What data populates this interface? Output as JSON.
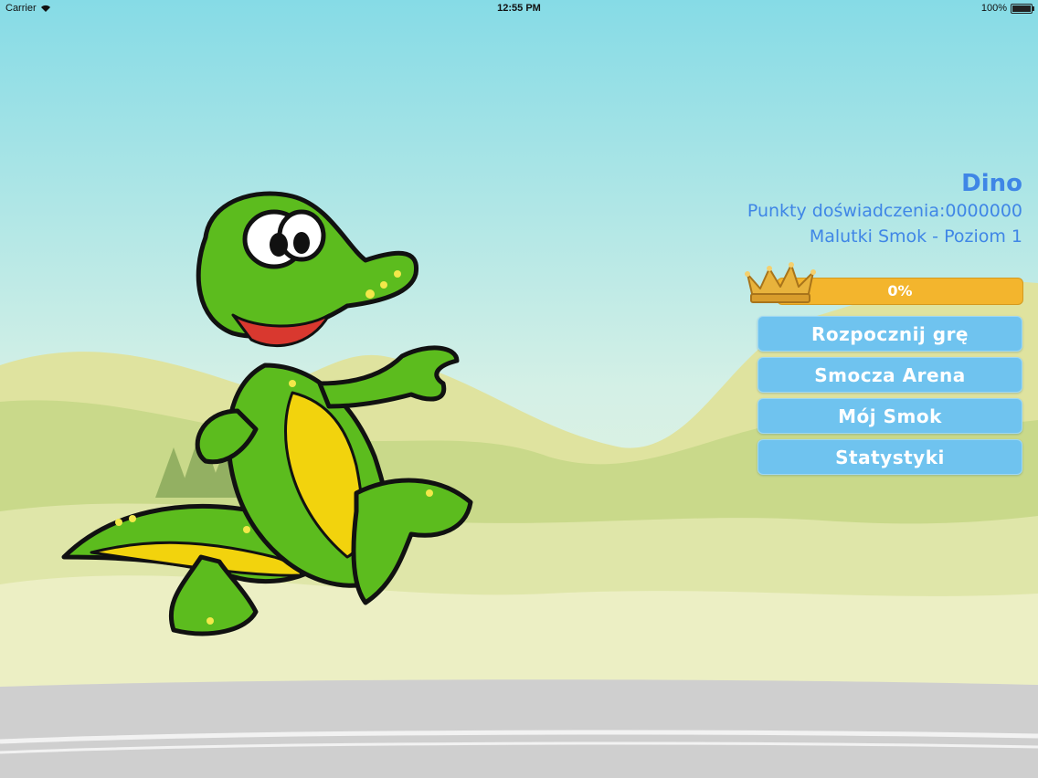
{
  "status_bar": {
    "carrier": "Carrier",
    "time": "12:55 PM",
    "battery": "100%"
  },
  "player": {
    "name": "Dino",
    "xp_label": "Punkty doświadczenia:",
    "xp_value": "0000000",
    "level_text": "Malutki Smok - Poziom 1"
  },
  "progress": {
    "label": "0%",
    "value": 0
  },
  "menu": {
    "start": "Rozpocznij grę",
    "arena": "Smocza Arena",
    "my_dragon": "Mój Smok",
    "stats": "Statystyki"
  },
  "colors": {
    "sky_top": "#86dbe6",
    "sky_bottom": "#f5f6d8",
    "hills": "#c9d98a",
    "accent_text": "#3f86e6",
    "button": "#6fc3ef",
    "progress": "#f3b52d"
  },
  "icons": {
    "wifi": "wifi-icon",
    "battery": "battery-icon",
    "crown": "crown-icon"
  }
}
